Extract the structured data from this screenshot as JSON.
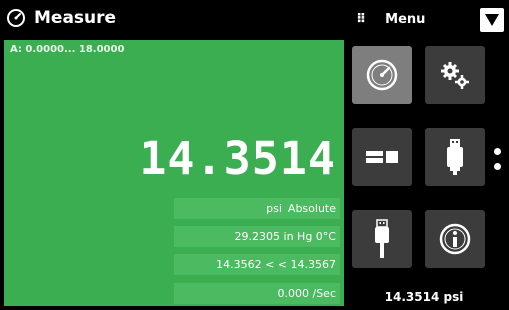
{
  "header": {
    "title": "Measure",
    "title_icon": "gauge-icon",
    "menu_label": "Menu",
    "menu_icon": "grip-icon",
    "dropdown_icon": "triangle-down-icon"
  },
  "measure": {
    "range": "A: 0.0000... 18.0000",
    "reading": "14.3514",
    "unit": "psi",
    "mode": "Absolute",
    "alt_reading": "29.2305 in Hg 0°C",
    "range_limits": "14.3562 < < 14.3567",
    "rate": "0.000 /Sec"
  },
  "menu": {
    "tiles": [
      {
        "icon": "gauge-icon",
        "active": true
      },
      {
        "icon": "gears-icon",
        "active": false
      },
      {
        "icon": "display-icon",
        "active": false
      },
      {
        "icon": "usb-device-icon",
        "active": false
      },
      {
        "icon": "usb-plug-icon",
        "active": false
      },
      {
        "icon": "info-icon",
        "active": false
      }
    ],
    "bottom_reading": "14.3514 psi"
  },
  "colors": {
    "panel": "#3cae52",
    "info_box": "#4cba60",
    "tile": "#3c3c3c",
    "tile_active": "#7e7e7e"
  }
}
